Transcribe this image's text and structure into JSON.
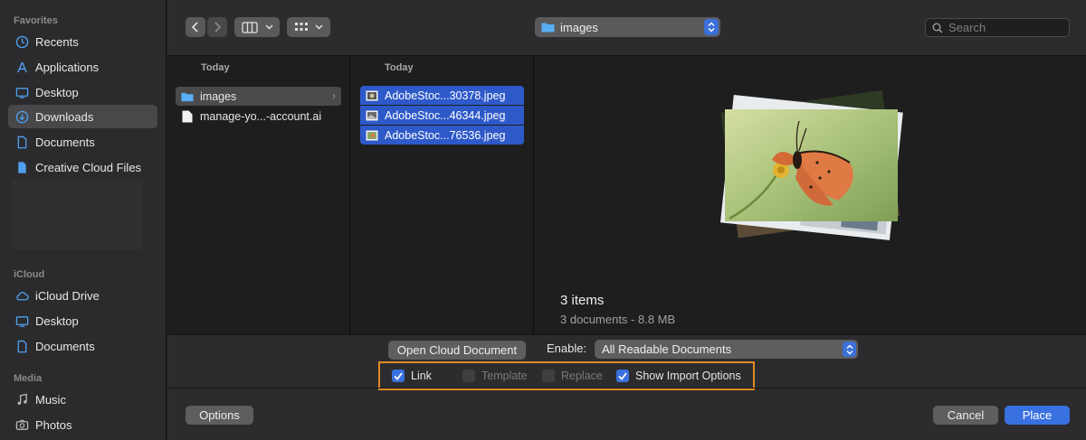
{
  "sidebar": {
    "favorites_title": "Favorites",
    "favorites": [
      {
        "label": "Recents",
        "icon": "clock-icon"
      },
      {
        "label": "Applications",
        "icon": "applications-icon"
      },
      {
        "label": "Desktop",
        "icon": "desktop-icon"
      },
      {
        "label": "Downloads",
        "icon": "downloads-icon",
        "selected": true
      },
      {
        "label": "Documents",
        "icon": "document-icon"
      },
      {
        "label": "Creative Cloud Files",
        "icon": "file-icon"
      }
    ],
    "icloud_title": "iCloud",
    "icloud": [
      {
        "label": "iCloud Drive",
        "icon": "cloud-icon"
      },
      {
        "label": "Desktop",
        "icon": "desktop-icon"
      },
      {
        "label": "Documents",
        "icon": "document-icon"
      }
    ],
    "media_title": "Media",
    "media": [
      {
        "label": "Music",
        "icon": "music-icon"
      },
      {
        "label": "Photos",
        "icon": "camera-icon"
      }
    ]
  },
  "toolbar": {
    "path_label": "images",
    "search_placeholder": "Search"
  },
  "browser": {
    "column1": {
      "header": "Today",
      "items": [
        {
          "name": "images",
          "type": "folder",
          "selected": true
        },
        {
          "name": "manage-yo...-account.ai",
          "type": "file"
        }
      ]
    },
    "column2": {
      "header": "Today",
      "items": [
        {
          "name": "AdobeStoc...30378.jpeg"
        },
        {
          "name": "AdobeStoc...46344.jpeg"
        },
        {
          "name": "AdobeStoc...76536.jpeg"
        }
      ]
    }
  },
  "preview": {
    "title": "3 items",
    "subtitle": "3 documents - 8.8 MB"
  },
  "bottom": {
    "open_cloud_label": "Open Cloud Document",
    "enable_label": "Enable:",
    "enable_value": "All Readable Documents",
    "checkboxes": [
      {
        "label": "Link",
        "checked": true,
        "enabled": true
      },
      {
        "label": "Template",
        "checked": false,
        "enabled": false
      },
      {
        "label": "Replace",
        "checked": false,
        "enabled": false
      },
      {
        "label": "Show Import Options",
        "checked": true,
        "enabled": true
      }
    ],
    "options_label": "Options",
    "cancel_label": "Cancel",
    "place_label": "Place"
  },
  "colors": {
    "accent": "#3a71e0",
    "selection": "#2e59c9",
    "highlight_box": "#e08a26"
  }
}
